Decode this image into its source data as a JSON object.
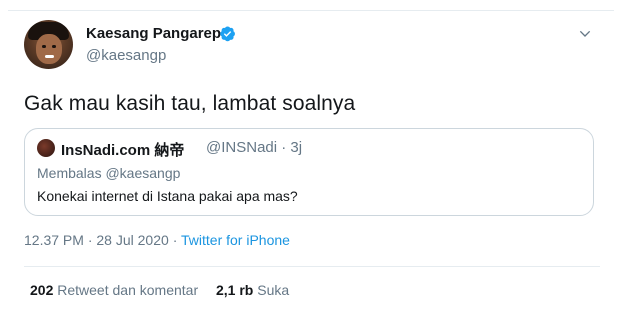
{
  "tweet": {
    "author_name": "Kaesang Pangarep",
    "author_handle": "@kaesangp",
    "text": "Gak mau kasih tau, lambat soalnya",
    "time": "12.37 PM",
    "date": "28 Jul 2020",
    "source": "Twitter for iPhone",
    "separator": "·"
  },
  "quoted": {
    "author_name": "InsNadi.com 納帝",
    "author_handle": "@INSNadi · 3j",
    "reply_to": "Membalas @kaesangp",
    "text": "Konekai internet di Istana pakai apa mas?"
  },
  "stats": {
    "retweet_count": "202",
    "retweet_label": "Retweet dan komentar",
    "like_count": "2,1 rb",
    "like_label": "Suka"
  },
  "icons": {
    "verified": "verified-badge-icon",
    "menu": "chevron-down-icon"
  },
  "colors": {
    "link": "#1b95e0",
    "muted": "#657786",
    "text": "#14171a",
    "border": "#ccd6dd",
    "verified": "#1da1f2"
  }
}
